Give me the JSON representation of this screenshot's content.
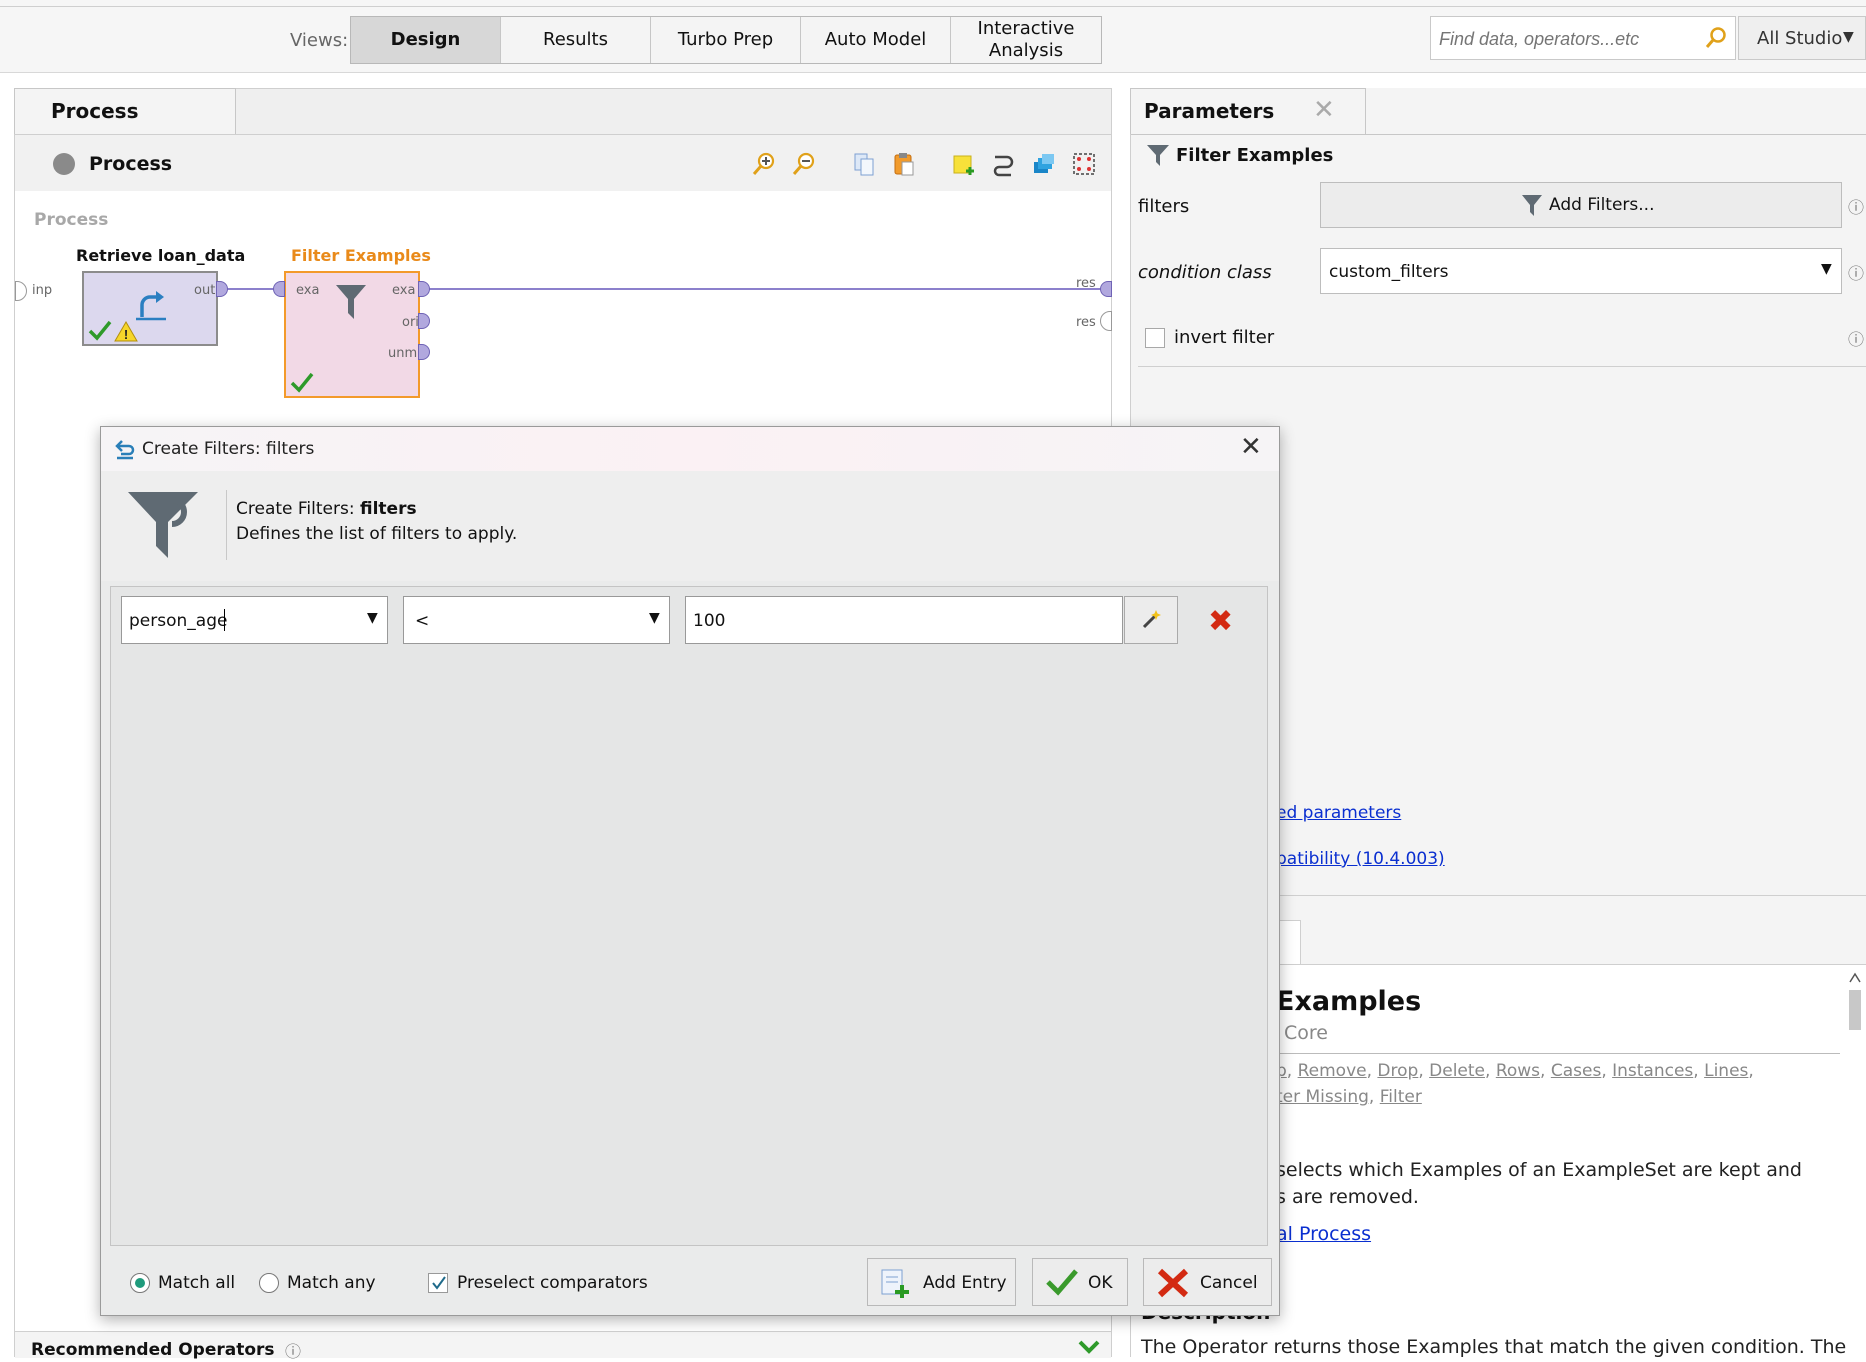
{
  "toolbar": {
    "views_label": "Views:",
    "views": [
      "Design",
      "Results",
      "Turbo Prep",
      "Auto Model",
      "Interactive Analysis"
    ],
    "active_view": "Design",
    "search_placeholder": "Find data, operators...etc",
    "studio_select": "All Studio"
  },
  "process": {
    "tab_label": "Process",
    "header_label": "Process",
    "canvas_title": "Process",
    "inp_label": "inp",
    "res_labels": [
      "res",
      "res"
    ],
    "operators": [
      {
        "title": "Retrieve loan_data",
        "ports_out": [
          "out"
        ]
      },
      {
        "title": "Filter Examples",
        "ports_in": [
          "exa"
        ],
        "ports_out": [
          "exa",
          "ori",
          "unm"
        ]
      }
    ],
    "recommended_label": "Recommended Operators"
  },
  "parameters": {
    "tab_label": "Parameters",
    "operator_name": "Filter Examples",
    "filters_label": "filters",
    "filters_button": "Add Filters...",
    "condition_label": "condition class",
    "condition_value": "custom_filters",
    "invert_label": "invert filter",
    "invert_checked": false,
    "link_expert": "ed parameters",
    "link_compat": "patibility (10.4.003)"
  },
  "help": {
    "title": "Examples",
    "group": "Core",
    "tags_line1": [
      "p",
      "Remove",
      "Drop",
      "Delete",
      "Rows",
      "Cases",
      "Instances",
      "Lines"
    ],
    "tags_line2": [
      "ter Missing",
      "Filter"
    ],
    "desc_line1": "selects which Examples of an ExampleSet are kept and",
    "desc_line2": "s are removed.",
    "link": "al Process",
    "desc_title": "Description",
    "desc2": "The Operator returns those Examples that match the given condition. The"
  },
  "dialog": {
    "title": "Create Filters: filters",
    "head_prefix": "Create Filters: ",
    "head_bold": "filters",
    "head_desc": "Defines the list of filters to apply.",
    "filter_row": {
      "attribute": "person_age",
      "operator": "<",
      "value": "100"
    },
    "match_all_label": "Match all",
    "match_any_label": "Match any",
    "match_mode": "all",
    "preselect_label": "Preselect comparators",
    "preselect_checked": true,
    "add_entry_label": "Add Entry",
    "ok_label": "OK",
    "cancel_label": "Cancel"
  },
  "colors": {
    "accent_orange": "#e98a1a",
    "link_blue": "#0a2fd0",
    "remove_red": "#d32a12",
    "ok_green": "#3a9a2c",
    "radio_teal": "#1f9b7c"
  }
}
